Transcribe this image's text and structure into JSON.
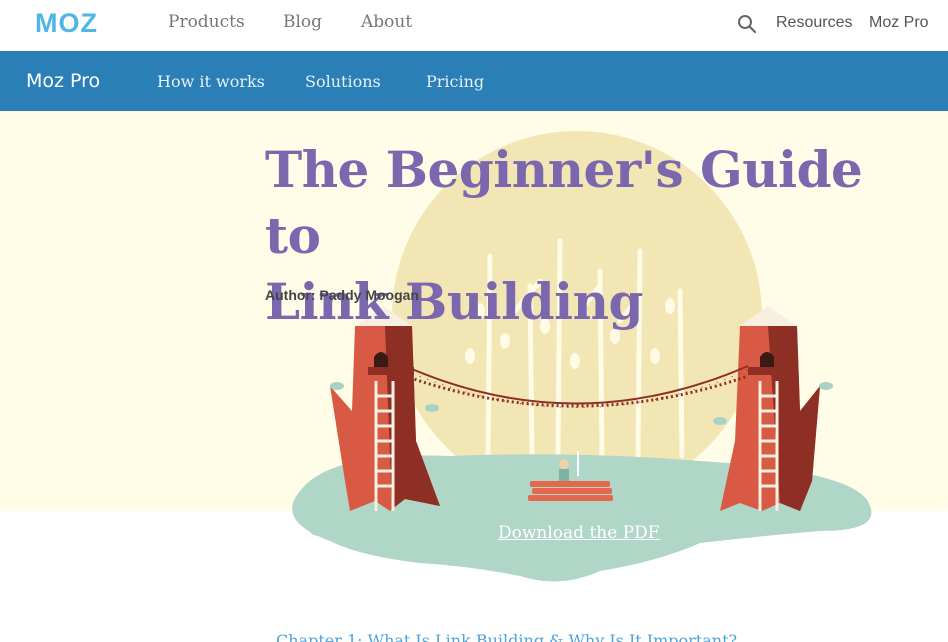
{
  "topnav": {
    "logo": "MOZ",
    "links": [
      "Products",
      "Blog",
      "About"
    ],
    "right_links": [
      "Resources",
      "Moz Pro"
    ]
  },
  "subnav": {
    "brand": "Moz Pro",
    "links": [
      "How it works",
      "Solutions",
      "Pricing"
    ]
  },
  "hero": {
    "title_line1": "The Beginner's Guide to",
    "title_line2": "Link Building",
    "author": "Author: Paddy Moogan",
    "download": "Download the PDF"
  },
  "content": {
    "chapter_link": "Chapter 1: What Is Link Building & Why Is It Important?"
  },
  "colors": {
    "brand_blue": "#4fb6e5",
    "subnav_bg": "#2b7fb7",
    "title_purple": "#7a67ad",
    "hero_bg": "#fffde8"
  }
}
